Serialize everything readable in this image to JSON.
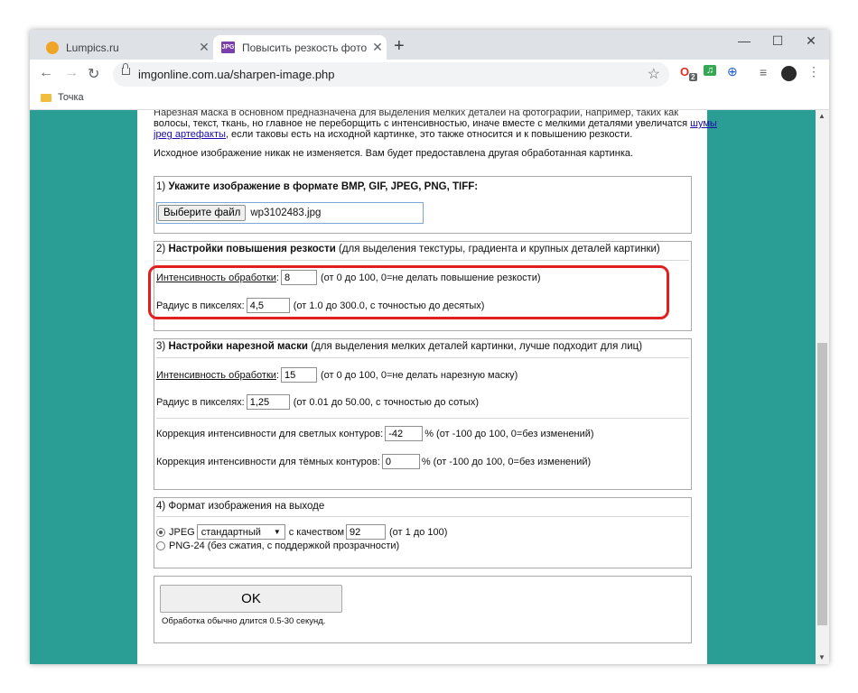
{
  "browser": {
    "tabs": [
      {
        "title": "Lumpics.ru"
      },
      {
        "title": "Повысить резкость фото и нар",
        "favicon": "JPG"
      }
    ],
    "url": "imgonline.com.ua/sharpen-image.php",
    "bookmark": "Точка",
    "extensions": {
      "badge": "2"
    }
  },
  "intro": {
    "line1": "Нарезная маска в основном предназначена для выделения мелких деталей на фотографии, например, таких как",
    "line2_pre": "волосы, текст, ткань, но главное не переборщить с интенсивностью, иначе вместе с мелкими деталями увеличатся",
    "link_noise": "шумы",
    "link_artifacts": "jpeg артефакты",
    "line3_post": ", если таковы есть на исходной картинке, это также относится и к повышению резкости.",
    "line4": "Исходное изображение никак не изменяется. Вам будет предоставлена другая обработанная картинка."
  },
  "section1": {
    "num": "1)",
    "title": "Укажите изображение в формате BMP, GIF, JPEG, PNG, TIFF:",
    "file_button": "Выберите файл",
    "file_name": "wp3102483.jpg"
  },
  "section2": {
    "num": "2)",
    "title": "Настройки повышения резкости",
    "subtitle": "(для выделения текстуры, градиента и крупных деталей картинки)",
    "intensity_label": "Интенсивность обработки",
    "intensity_value": "8",
    "intensity_hint": "(от 0 до 100, 0=не делать повышение резкости)",
    "radius_label": "Радиус в пикселях:",
    "radius_value": "4,5",
    "radius_hint": "(от 1.0 до 300.0, с точностью до десятых)"
  },
  "section3": {
    "num": "3)",
    "title": "Настройки нарезной маски",
    "subtitle": "(для выделения мелких деталей картинки, лучше подходит для лиц)",
    "intensity_label": "Интенсивность обработки",
    "intensity_value": "15",
    "intensity_hint": "(от 0 до 100, 0=не делать нарезную маску)",
    "radius_label": "Радиус в пикселях:",
    "radius_value": "1,25",
    "radius_hint": "(от 0.01 до 50.00, с точностью до сотых)",
    "light_label": "Коррекция интенсивности для светлых контуров:",
    "light_value": "-42",
    "light_hint": "% (от -100 до 100, 0=без изменений)",
    "dark_label": "Коррекция интенсивности для тёмных контуров:",
    "dark_value": "0",
    "dark_hint": "% (от -100 до 100, 0=без изменений)"
  },
  "section4": {
    "title": "4) Формат изображения на выходе",
    "jpeg_label": "JPEG",
    "jpeg_mode": "стандартный",
    "quality_label": "с качеством",
    "quality_value": "92",
    "quality_hint": "(от 1 до 100)",
    "png_label": "PNG-24 (без сжатия, с поддержкой прозрачности)"
  },
  "submit": {
    "ok_label": "OK",
    "note": "Обработка обычно длится 0.5-30 секунд."
  }
}
